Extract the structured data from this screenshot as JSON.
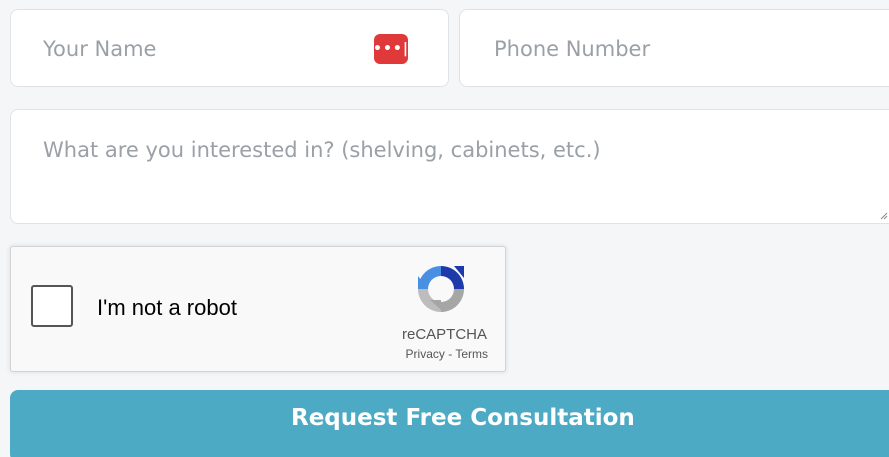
{
  "form": {
    "name_placeholder": "Your Name",
    "phone_placeholder": "Phone Number",
    "interest_placeholder": "What are you interested in? (shelving, cabinets, etc.)",
    "password_manager_icon": "password-dots-icon",
    "submit_label": "Request Free Consultation"
  },
  "recaptcha": {
    "checkbox_label": "I'm not a robot",
    "brand": "reCAPTCHA",
    "privacy_link": "Privacy",
    "separator": " - ",
    "terms_link": "Terms",
    "logo_icon": "recaptcha-logo-icon"
  },
  "colors": {
    "button_bg": "#4daac4",
    "password_icon_bg": "#e0393a",
    "field_border": "#dfe3e8",
    "page_bg": "#f4f6f8"
  }
}
